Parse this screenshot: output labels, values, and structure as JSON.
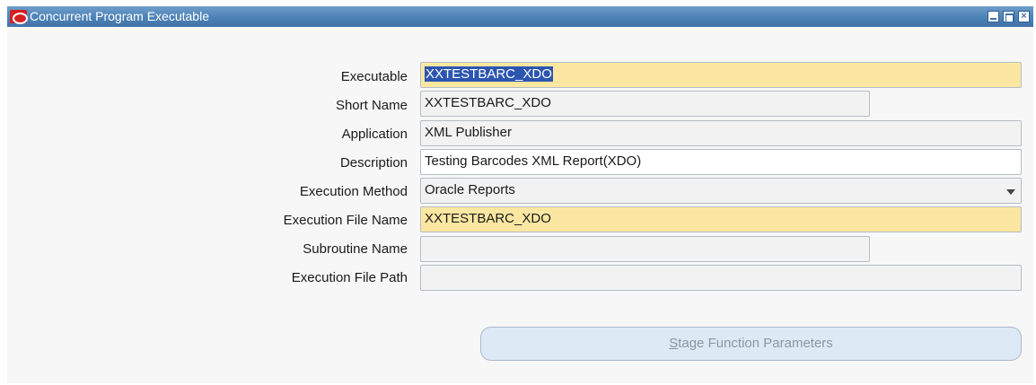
{
  "window": {
    "title": "Concurrent Program Executable"
  },
  "form": {
    "executable": {
      "label": "Executable",
      "value": "XXTESTBARC_XDO"
    },
    "short_name": {
      "label": "Short Name",
      "value": "XXTESTBARC_XDO"
    },
    "application": {
      "label": "Application",
      "value": "XML Publisher"
    },
    "description": {
      "label": "Description",
      "value": "Testing Barcodes XML Report(XDO)"
    },
    "execution_method": {
      "label": "Execution Method",
      "value": "Oracle Reports"
    },
    "execution_file_name": {
      "label": "Execution File Name",
      "value": "XXTESTBARC_XDO"
    },
    "subroutine_name": {
      "label": "Subroutine Name",
      "value": ""
    },
    "execution_file_path": {
      "label": "Execution File Path",
      "value": ""
    }
  },
  "stage_button": {
    "mnemonic": "S",
    "label_rest": "tage Function Parameters"
  },
  "colors": {
    "titlebar": "#4f84b8",
    "required_field": "#fbe7a1",
    "selection": "#2b55b0"
  }
}
